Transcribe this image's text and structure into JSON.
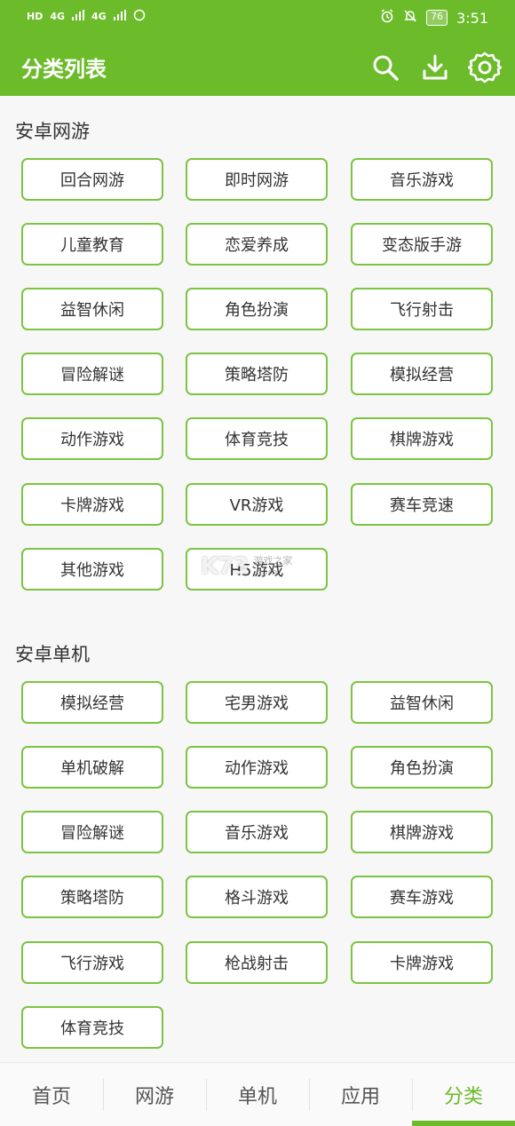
{
  "status_bar": {
    "sim1": "HD",
    "sim2": "HD",
    "network1": "4G",
    "network2": "4G",
    "battery": "76",
    "time": "3:51"
  },
  "header": {
    "title": "分类列表",
    "icons": [
      "search-icon",
      "download-icon",
      "settings-icon"
    ],
    "bg_color": "#6bbb2a"
  },
  "sections": [
    {
      "title": "安卓网游",
      "tags": [
        "回合网游",
        "即时网游",
        "音乐游戏",
        "儿童教育",
        "恋爱养成",
        "变态版手游",
        "益智休闲",
        "角色扮演",
        "飞行射击",
        "冒险解谜",
        "策略塔防",
        "模拟经营",
        "动作游戏",
        "体育竞技",
        "棋牌游戏",
        "卡牌游戏",
        "VR游戏",
        "赛车竞速",
        "其他游戏",
        "H5游戏"
      ]
    },
    {
      "title": "安卓单机",
      "tags": [
        "模拟经营",
        "宅男游戏",
        "益智休闲",
        "单机破解",
        "动作游戏",
        "角色扮演",
        "冒险解谜",
        "音乐游戏",
        "棋牌游戏",
        "策略塔防",
        "格斗游戏",
        "赛车游戏",
        "飞行游戏",
        "枪战射击",
        "卡牌游戏",
        "体育竞技"
      ]
    }
  ],
  "tabs": [
    "首页",
    "网游",
    "单机",
    "应用",
    "分类"
  ],
  "active_tab": "分类",
  "watermark": {
    "logo": "K73",
    "text_line1": "游戏之家",
    "text_line2": ".com"
  }
}
